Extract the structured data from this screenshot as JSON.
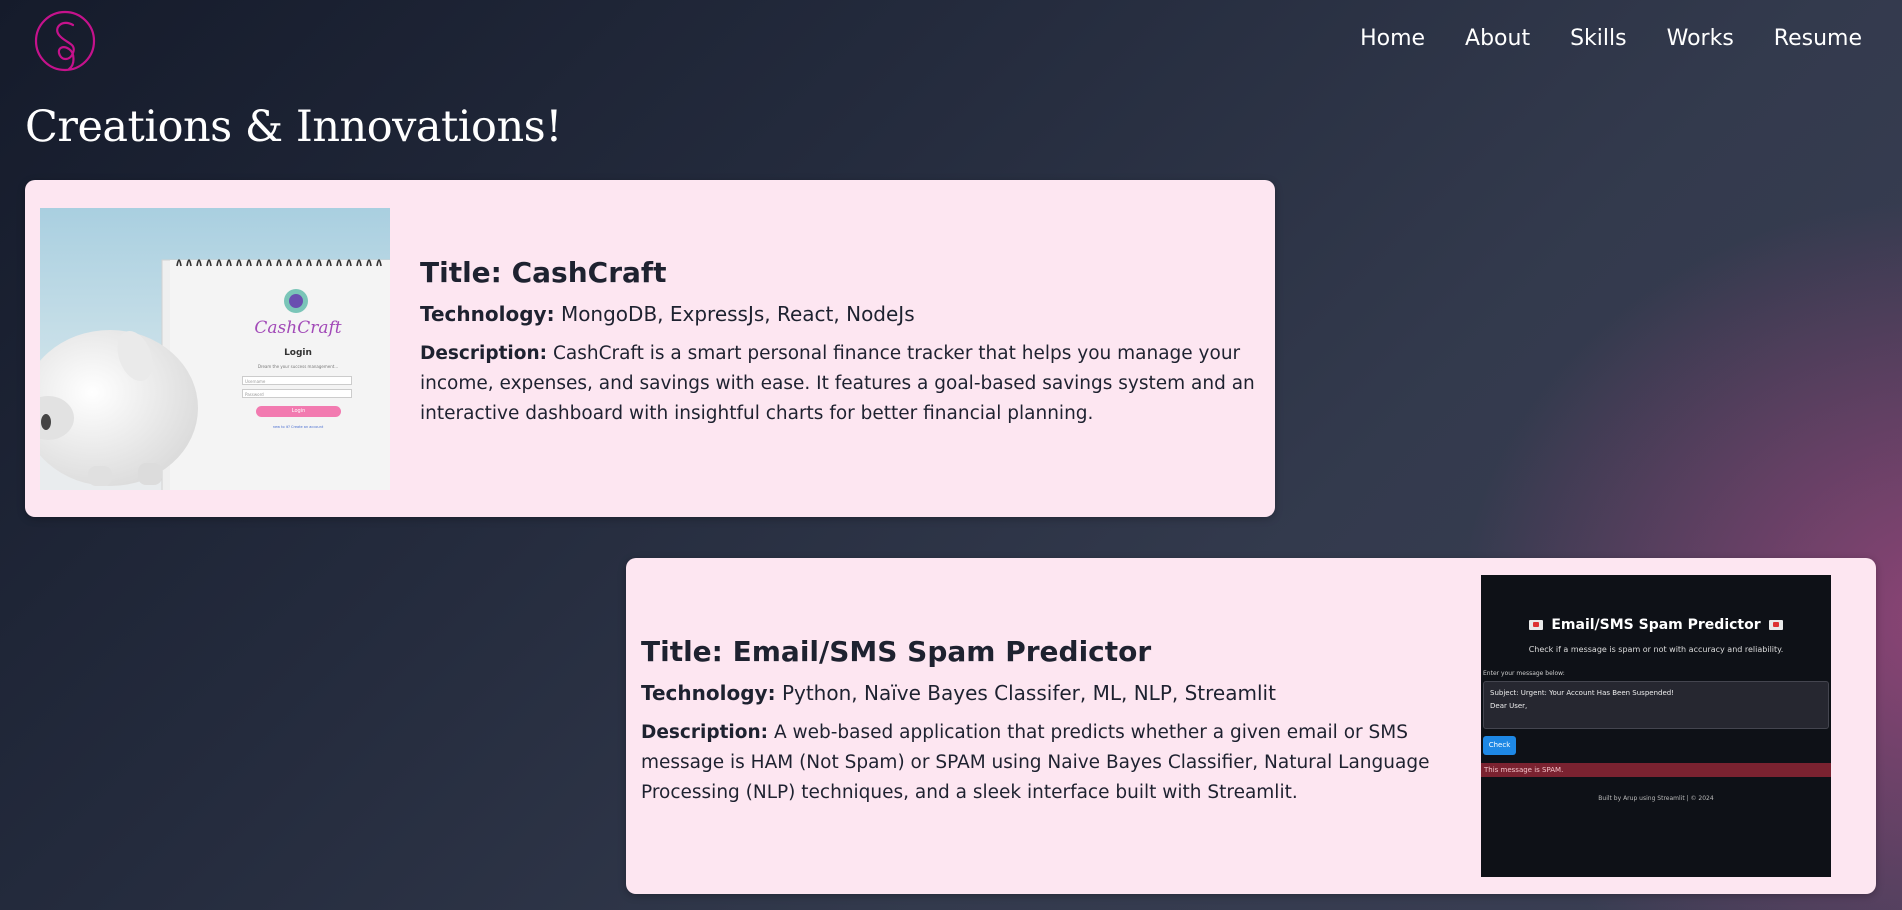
{
  "nav": {
    "items": [
      "Home",
      "About",
      "Skills",
      "Works",
      "Resume"
    ]
  },
  "page": {
    "heading": "Creations & Innovations!"
  },
  "projects": [
    {
      "title": "Title: CashCraft",
      "tech_label": "Technology:",
      "tech": "MongoDB, ExpressJs, React, NodeJs",
      "desc_label": "Description:",
      "desc": "CashCraft is a smart personal finance tracker that helps you manage your income, expenses, and savings with ease. It features a goal-based savings system and an interactive dashboard with insightful charts for better financial planning.",
      "screenshot": {
        "brand": "CashCraft",
        "login_heading": "Login",
        "tagline": "Dream the your success management...",
        "username_placeholder": "Username",
        "password_placeholder": "Password",
        "login_button": "Login",
        "footer_text": "new to it? Create an account"
      }
    },
    {
      "title": "Title: Email/SMS Spam Predictor",
      "tech_label": "Technology:",
      "tech": "Python, Naïve Bayes Classifer, ML, NLP, Streamlit",
      "desc_label": "Description:",
      "desc": "A web-based application that predicts whether a given email or SMS message is HAM (Not Spam) or SPAM using Naive Bayes Classifier, Natural Language Processing (NLP) techniques, and a sleek interface built with Streamlit.",
      "screenshot": {
        "heading": "Email/SMS Spam Predictor",
        "subheading": "Check if a message is spam or not with accuracy and reliability.",
        "input_label": "Enter your message below:",
        "message_line1": "Subject: Urgent: Your Account Has Been Suspended!",
        "message_line2": "Dear User,",
        "check_button": "Check",
        "result": "This message is SPAM.",
        "footer": "Built by Arup using Streamlit | © 2024"
      }
    }
  ],
  "colors": {
    "card_bg": "#fde6f1",
    "logo": "#c5128c",
    "text_dark": "#1e2230",
    "spam_bar": "#7a2230",
    "check_button": "#1e88e5"
  }
}
